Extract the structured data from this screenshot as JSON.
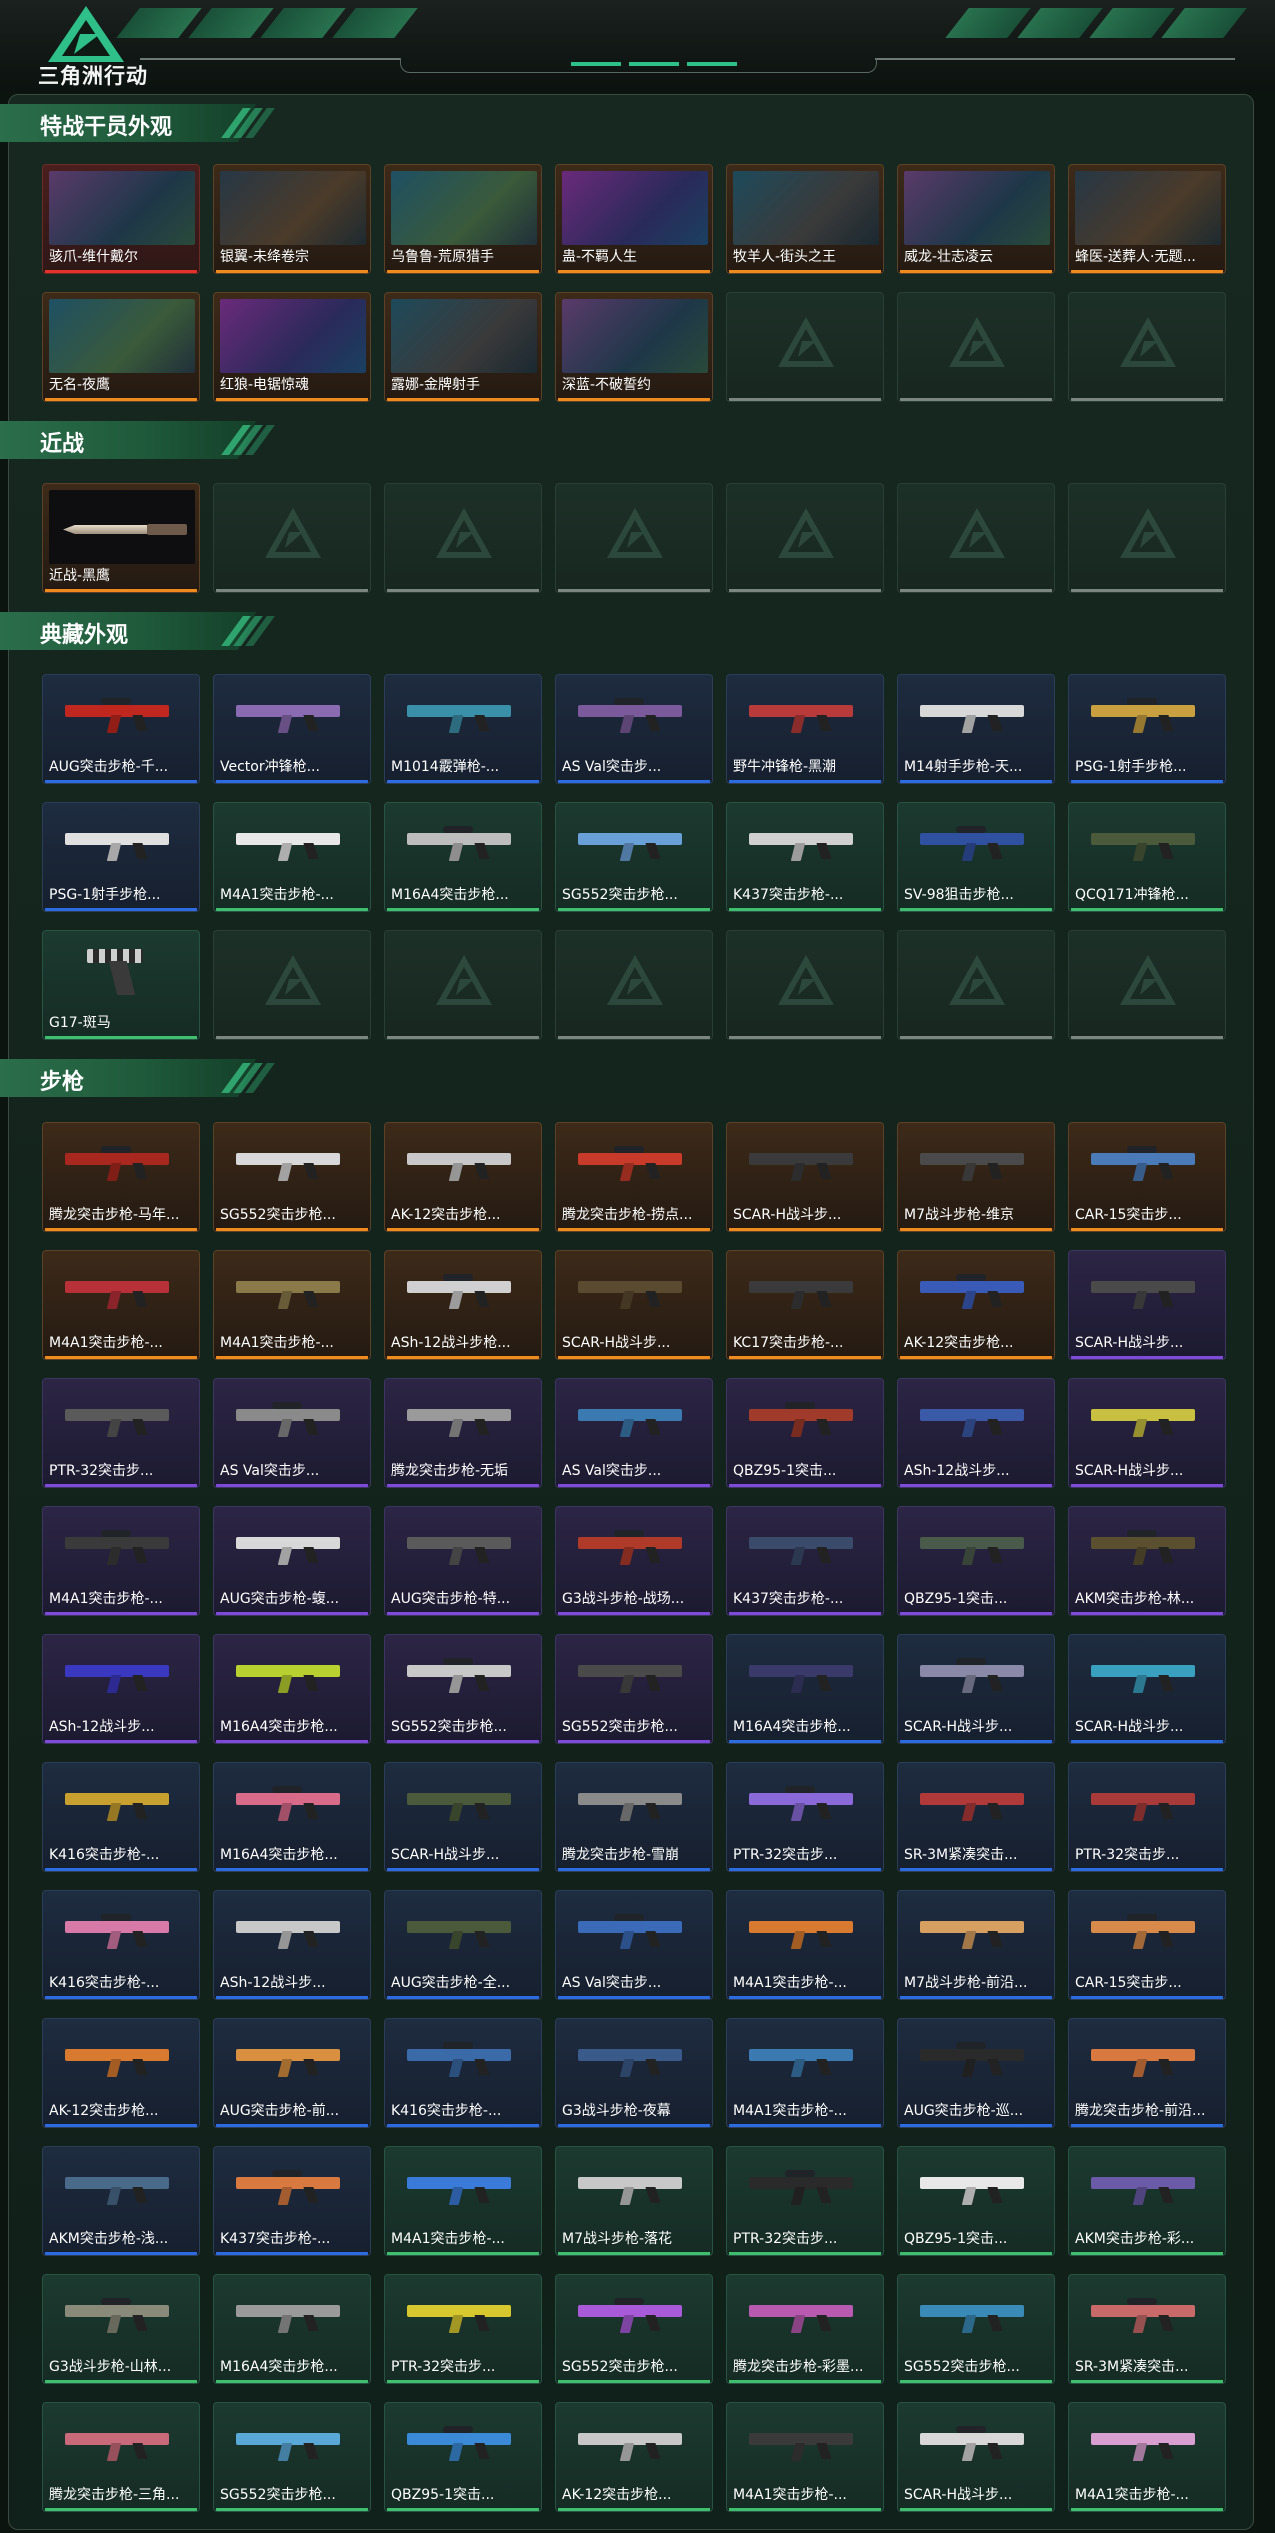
{
  "brand": "三角洲行动",
  "colors": {
    "red": "#e2322b",
    "gold": "#ef8a1f",
    "purple": "#7d4bd8",
    "blue": "#2d6be0",
    "green": "#3fbf6e"
  },
  "sections": [
    {
      "title": "特战干员外观",
      "items": [
        {
          "label": "骇爪-维什戴尔",
          "rarity": "red",
          "kind": "operator"
        },
        {
          "label": "银翼-未绛卷宗",
          "rarity": "gold",
          "kind": "operator"
        },
        {
          "label": "乌鲁鲁-荒原猎手",
          "rarity": "gold",
          "kind": "operator"
        },
        {
          "label": "蛊-不羁人生",
          "rarity": "gold",
          "kind": "operator"
        },
        {
          "label": "牧羊人-街头之王",
          "rarity": "gold",
          "kind": "operator"
        },
        {
          "label": "威龙-壮志凌云",
          "rarity": "gold",
          "kind": "operator"
        },
        {
          "label": "蜂医-送葬人·无题...",
          "rarity": "gold",
          "kind": "operator"
        },
        {
          "label": "无名-夜鹰",
          "rarity": "gold",
          "kind": "operator"
        },
        {
          "label": "红狼-电锯惊魂",
          "rarity": "gold",
          "kind": "operator"
        },
        {
          "label": "露娜-金牌射手",
          "rarity": "gold",
          "kind": "operator"
        },
        {
          "label": "深蓝-不破誓约",
          "rarity": "gold",
          "kind": "operator"
        }
      ],
      "slots": 14
    },
    {
      "title": "近战",
      "items": [
        {
          "label": "近战-黑鹰",
          "rarity": "gold",
          "kind": "knife"
        }
      ],
      "slots": 7
    },
    {
      "title": "典藏外观",
      "items": [
        {
          "label": "AUG突击步枪-千...",
          "rarity": "blue",
          "kind": "gun",
          "color": "#c0281f"
        },
        {
          "label": "Vector冲锋枪...",
          "rarity": "blue",
          "kind": "gun",
          "color": "#8a6ab0"
        },
        {
          "label": "M1014霰弹枪-...",
          "rarity": "blue",
          "kind": "gun",
          "color": "#3a90a8"
        },
        {
          "label": "AS Val突击步...",
          "rarity": "blue",
          "kind": "gun",
          "color": "#7a5a9a"
        },
        {
          "label": "野牛冲锋枪-黑潮",
          "rarity": "blue",
          "kind": "gun",
          "color": "#b83a3a"
        },
        {
          "label": "M14射手步枪-天...",
          "rarity": "blue",
          "kind": "gun",
          "color": "#d8d8d8"
        },
        {
          "label": "PSG-1射手步枪...",
          "rarity": "blue",
          "kind": "gun",
          "color": "#c8a040"
        },
        {
          "label": "PSG-1射手步枪...",
          "rarity": "blue",
          "kind": "gun",
          "color": "#e0e0e0"
        },
        {
          "label": "M4A1突击步枪-...",
          "rarity": "green",
          "kind": "gun",
          "color": "#e8e8e8"
        },
        {
          "label": "M16A4突击步枪...",
          "rarity": "green",
          "kind": "gun",
          "color": "#bdbdbd"
        },
        {
          "label": "SG552突击步枪...",
          "rarity": "green",
          "kind": "gun",
          "color": "#6aa0d8"
        },
        {
          "label": "K437突击步枪-...",
          "rarity": "green",
          "kind": "gun",
          "color": "#d0d0d0"
        },
        {
          "label": "SV-98狙击步枪...",
          "rarity": "green",
          "kind": "gun",
          "color": "#3050a0"
        },
        {
          "label": "QCQ171冲锋枪...",
          "rarity": "green",
          "kind": "gun",
          "color": "#4a5a3a"
        },
        {
          "label": "G17-斑马",
          "rarity": "green",
          "kind": "pistol"
        }
      ],
      "slots": 21
    },
    {
      "title": "步枪",
      "items": [
        {
          "label": "腾龙突击步枪-马年...",
          "rarity": "gold",
          "kind": "gun",
          "color": "#a8281f"
        },
        {
          "label": "SG552突击步枪...",
          "rarity": "gold",
          "kind": "gun",
          "color": "#d8d8d8"
        },
        {
          "label": "AK-12突击步枪...",
          "rarity": "gold",
          "kind": "gun",
          "color": "#c8c8c8"
        },
        {
          "label": "腾龙突击步枪-捞点...",
          "rarity": "gold",
          "kind": "gun",
          "color": "#c83a2a"
        },
        {
          "label": "SCAR-H战斗步...",
          "rarity": "gold",
          "kind": "gun",
          "color": "#3a3a3a"
        },
        {
          "label": "M7战斗步枪-维京",
          "rarity": "gold",
          "kind": "gun",
          "color": "#4a4a4a"
        },
        {
          "label": "CAR-15突击步...",
          "rarity": "gold",
          "kind": "gun",
          "color": "#4a7ab8"
        },
        {
          "label": "M4A1突击步枪-...",
          "rarity": "gold",
          "kind": "gun",
          "color": "#b83038"
        },
        {
          "label": "M4A1突击步枪-...",
          "rarity": "gold",
          "kind": "gun",
          "color": "#8a7a4a"
        },
        {
          "label": "ASh-12战斗步枪...",
          "rarity": "gold",
          "kind": "gun",
          "color": "#d0d0d0"
        },
        {
          "label": "SCAR-H战斗步...",
          "rarity": "gold",
          "kind": "gun",
          "color": "#5a4a30"
        },
        {
          "label": "KC17突击步枪-...",
          "rarity": "gold",
          "kind": "gun",
          "color": "#3a3a3a"
        },
        {
          "label": "AK-12突击步枪...",
          "rarity": "gold",
          "kind": "gun",
          "color": "#3a5ab8"
        },
        {
          "label": "SCAR-H战斗步...",
          "rarity": "purple",
          "kind": "gun",
          "color": "#4a4a4a"
        },
        {
          "label": "PTR-32突击步...",
          "rarity": "purple",
          "kind": "gun",
          "color": "#5a5a5a"
        },
        {
          "label": "AS Val突击步...",
          "rarity": "purple",
          "kind": "gun",
          "color": "#8a8a8a"
        },
        {
          "label": "腾龙突击步枪-无垢",
          "rarity": "purple",
          "kind": "gun",
          "color": "#9a9a9a"
        },
        {
          "label": "AS Val突击步...",
          "rarity": "purple",
          "kind": "gun",
          "color": "#3a7ab0"
        },
        {
          "label": "QBZ95-1突击...",
          "rarity": "purple",
          "kind": "gun",
          "color": "#a03a2a"
        },
        {
          "label": "ASh-12战斗步...",
          "rarity": "purple",
          "kind": "gun",
          "color": "#3a5aa8"
        },
        {
          "label": "SCAR-H战斗步...",
          "rarity": "purple",
          "kind": "gun",
          "color": "#c8c040"
        },
        {
          "label": "M4A1突击步枪-...",
          "rarity": "purple",
          "kind": "gun",
          "color": "#3a3a3a"
        },
        {
          "label": "AUG突击步枪-蝮...",
          "rarity": "purple",
          "kind": "gun",
          "color": "#d8d8d8"
        },
        {
          "label": "AUG突击步枪-特...",
          "rarity": "purple",
          "kind": "gun",
          "color": "#5a5a5a"
        },
        {
          "label": "G3战斗步枪-战场...",
          "rarity": "purple",
          "kind": "gun",
          "color": "#b03a2a"
        },
        {
          "label": "K437突击步枪-...",
          "rarity": "purple",
          "kind": "gun",
          "color": "#3a4a6a"
        },
        {
          "label": "QBZ95-1突击...",
          "rarity": "purple",
          "kind": "gun",
          "color": "#4a5a4a"
        },
        {
          "label": "AKM突击步枪-林...",
          "rarity": "purple",
          "kind": "gun",
          "color": "#5a5030"
        },
        {
          "label": "ASh-12战斗步...",
          "rarity": "purple",
          "kind": "gun",
          "color": "#3a38c0"
        },
        {
          "label": "M16A4突击步枪...",
          "rarity": "purple",
          "kind": "gun",
          "color": "#b8d030"
        },
        {
          "label": "SG552突击步枪...",
          "rarity": "purple",
          "kind": "gun",
          "color": "#c8c8c8"
        },
        {
          "label": "SG552突击步枪...",
          "rarity": "purple",
          "kind": "gun",
          "color": "#4a4a4a"
        },
        {
          "label": "M16A4突击步枪...",
          "rarity": "blue",
          "kind": "gun",
          "color": "#3a3a6a"
        },
        {
          "label": "SCAR-H战斗步...",
          "rarity": "blue",
          "kind": "gun",
          "color": "#8a8aa8"
        },
        {
          "label": "SCAR-H战斗步...",
          "rarity": "blue",
          "kind": "gun",
          "color": "#3aa0c0"
        },
        {
          "label": "K416突击步枪-...",
          "rarity": "blue",
          "kind": "gun",
          "color": "#c8a030"
        },
        {
          "label": "M16A4突击步枪...",
          "rarity": "blue",
          "kind": "gun",
          "color": "#d86a8a"
        },
        {
          "label": "SCAR-H战斗步...",
          "rarity": "blue",
          "kind": "gun",
          "color": "#4a5a3a"
        },
        {
          "label": "腾龙突击步枪-雪崩",
          "rarity": "blue",
          "kind": "gun",
          "color": "#8a8a8a"
        },
        {
          "label": "PTR-32突击步...",
          "rarity": "blue",
          "kind": "gun",
          "color": "#8a6ad8"
        },
        {
          "label": "SR-3M紧凑突击...",
          "rarity": "blue",
          "kind": "gun",
          "color": "#b03a3a"
        },
        {
          "label": "PTR-32突击步...",
          "rarity": "blue",
          "kind": "gun",
          "color": "#a83a3a"
        },
        {
          "label": "K416突击步枪-...",
          "rarity": "blue",
          "kind": "gun",
          "color": "#d87aa8"
        },
        {
          "label": "ASh-12战斗步...",
          "rarity": "blue",
          "kind": "gun",
          "color": "#c8c8c8"
        },
        {
          "label": "AUG突击步枪-全...",
          "rarity": "blue",
          "kind": "gun",
          "color": "#4a5a3a"
        },
        {
          "label": "AS Val突击步...",
          "rarity": "blue",
          "kind": "gun",
          "color": "#3a6ab8"
        },
        {
          "label": "M4A1突击步枪-...",
          "rarity": "blue",
          "kind": "gun",
          "color": "#d87a30"
        },
        {
          "label": "M7战斗步枪-前沿...",
          "rarity": "blue",
          "kind": "gun",
          "color": "#d8a060"
        },
        {
          "label": "CAR-15突击步...",
          "rarity": "blue",
          "kind": "gun",
          "color": "#d88a4a"
        },
        {
          "label": "AK-12突击步枪...",
          "rarity": "blue",
          "kind": "gun",
          "color": "#d87a30"
        },
        {
          "label": "AUG突击步枪-前...",
          "rarity": "blue",
          "kind": "gun",
          "color": "#d89040"
        },
        {
          "label": "K416突击步枪-...",
          "rarity": "blue",
          "kind": "gun",
          "color": "#3a6aa8"
        },
        {
          "label": "G3战斗步枪-夜幕",
          "rarity": "blue",
          "kind": "gun",
          "color": "#3a5a8a"
        },
        {
          "label": "M4A1突击步枪-...",
          "rarity": "blue",
          "kind": "gun",
          "color": "#3a7ab0"
        },
        {
          "label": "AUG突击步枪-巡...",
          "rarity": "blue",
          "kind": "gun",
          "color": "#2a2a2a"
        },
        {
          "label": "腾龙突击步枪-前沿...",
          "rarity": "blue",
          "kind": "gun",
          "color": "#d87a40"
        },
        {
          "label": "AKM突击步枪-浅...",
          "rarity": "blue",
          "kind": "gun",
          "color": "#4a6a8a"
        },
        {
          "label": "K437突击步枪-...",
          "rarity": "blue",
          "kind": "gun",
          "color": "#d87a40"
        },
        {
          "label": "M4A1突击步枪-...",
          "rarity": "green",
          "kind": "gun",
          "color": "#3a7ad8"
        },
        {
          "label": "M7战斗步枪-落花",
          "rarity": "green",
          "kind": "gun",
          "color": "#c8c8c8"
        },
        {
          "label": "PTR-32突击步...",
          "rarity": "green",
          "kind": "gun",
          "color": "#2a2a2a"
        },
        {
          "label": "QBZ95-1突击...",
          "rarity": "green",
          "kind": "gun",
          "color": "#e8e8e8"
        },
        {
          "label": "AKM突击步枪-彩...",
          "rarity": "green",
          "kind": "gun",
          "color": "#6a5aa8"
        },
        {
          "label": "G3战斗步枪-山林...",
          "rarity": "green",
          "kind": "gun",
          "color": "#8a8a7a"
        },
        {
          "label": "M16A4突击步枪...",
          "rarity": "green",
          "kind": "gun",
          "color": "#9a9a9a"
        },
        {
          "label": "PTR-32突击步...",
          "rarity": "green",
          "kind": "gun",
          "color": "#d8c830"
        },
        {
          "label": "SG552突击步枪...",
          "rarity": "green",
          "kind": "gun",
          "color": "#a85ad8"
        },
        {
          "label": "腾龙突击步枪-彩墨...",
          "rarity": "green",
          "kind": "gun",
          "color": "#b85ab0"
        },
        {
          "label": "SG552突击步枪...",
          "rarity": "green",
          "kind": "gun",
          "color": "#3a8ab8"
        },
        {
          "label": "SR-3M紧凑突击...",
          "rarity": "green",
          "kind": "gun",
          "color": "#c86a6a"
        },
        {
          "label": "腾龙突击步枪-三角...",
          "rarity": "green",
          "kind": "gun",
          "color": "#c86a7a"
        },
        {
          "label": "SG552突击步枪...",
          "rarity": "green",
          "kind": "gun",
          "color": "#5aa8d8"
        },
        {
          "label": "QBZ95-1突击...",
          "rarity": "green",
          "kind": "gun",
          "color": "#3a8ad8"
        },
        {
          "label": "AK-12突击步枪...",
          "rarity": "green",
          "kind": "gun",
          "color": "#c8c8c8"
        },
        {
          "label": "M4A1突击步枪-...",
          "rarity": "green",
          "kind": "gun",
          "color": "#3a3a3a"
        },
        {
          "label": "SCAR-H战斗步...",
          "rarity": "green",
          "kind": "gun",
          "color": "#d8d8d8"
        },
        {
          "label": "M4A1突击步枪-...",
          "rarity": "green",
          "kind": "gun",
          "color": "#d8a0d0"
        }
      ],
      "slots": 77
    }
  ]
}
